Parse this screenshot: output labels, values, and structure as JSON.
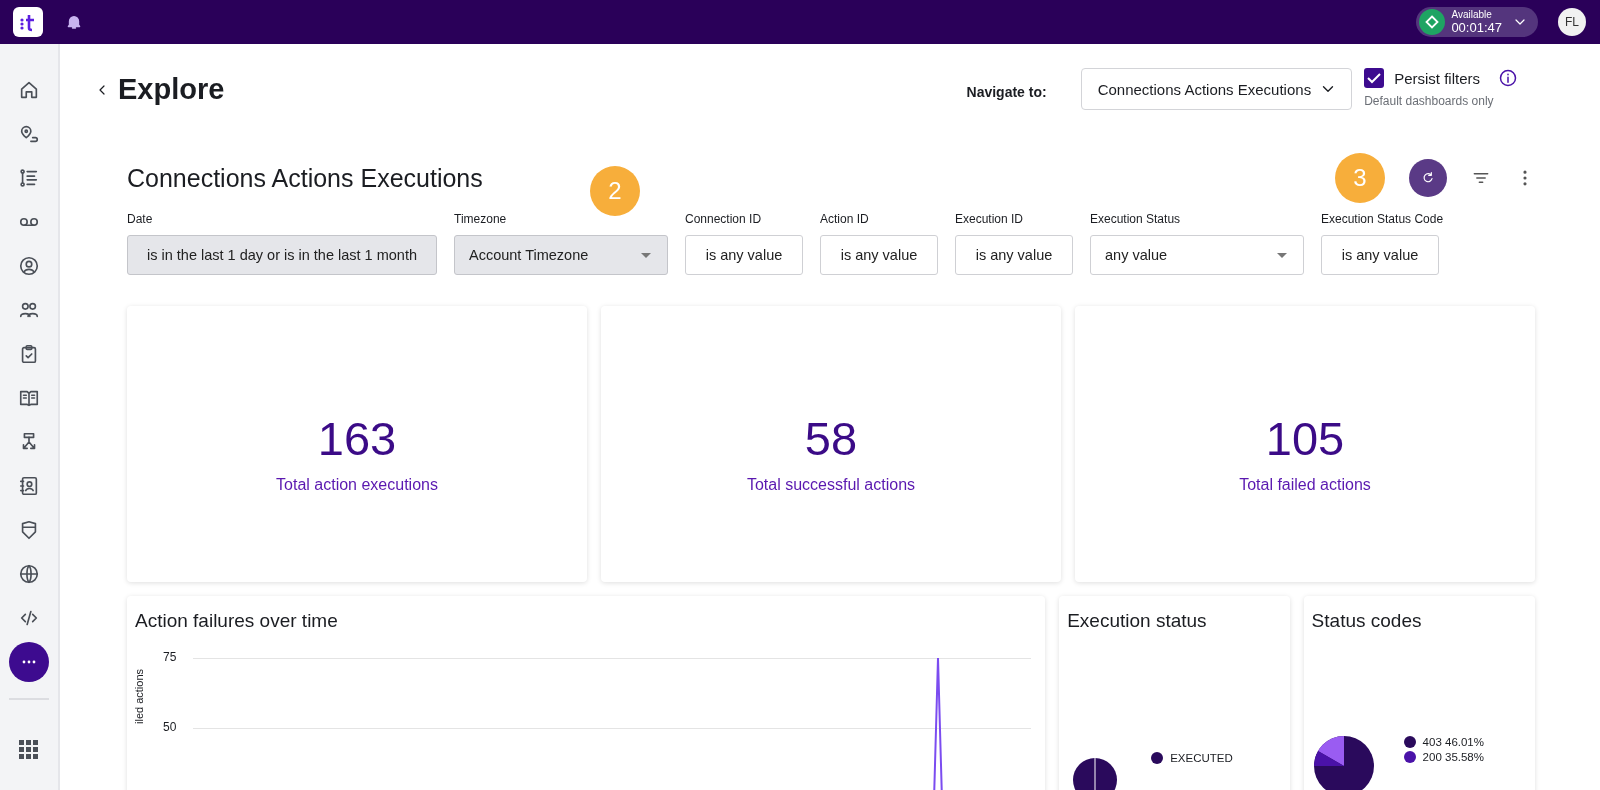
{
  "topbar": {
    "status": {
      "label": "Available",
      "timer": "00:01:47"
    },
    "avatar": "FL"
  },
  "page": {
    "title": "Explore",
    "navigate_label": "Navigate to:",
    "navigate_value": "Connections Actions Executions",
    "persist": {
      "label": "Persist filters",
      "checked": true,
      "hint": "Default dashboards only"
    }
  },
  "dashboard": {
    "title": "Connections Actions Executions",
    "filters": [
      {
        "label": "Date",
        "value": "is in the last 1 day or is in the last 1 month",
        "kind": "text",
        "highlighted": true
      },
      {
        "label": "Timezone",
        "value": "Account Timezone",
        "kind": "select",
        "highlighted": true
      },
      {
        "label": "Connection ID",
        "value": "is any value",
        "kind": "text",
        "highlighted": false
      },
      {
        "label": "Action ID",
        "value": "is any value",
        "kind": "text",
        "highlighted": false
      },
      {
        "label": "Execution ID",
        "value": "is any value",
        "kind": "text",
        "highlighted": false
      },
      {
        "label": "Execution Status",
        "value": "any value",
        "kind": "select",
        "highlighted": false
      },
      {
        "label": "Execution Status Code",
        "value": "is any value",
        "kind": "text",
        "highlighted": false
      }
    ],
    "kpis": [
      {
        "value": "163",
        "label": "Total action executions"
      },
      {
        "value": "58",
        "label": "Total successful actions"
      },
      {
        "value": "105",
        "label": "Total failed actions"
      }
    ],
    "failures_chart": {
      "title": "Action failures over time",
      "y_tick_labels": [
        "75",
        "50"
      ],
      "y_axis_title": "iled actions"
    },
    "execution_status": {
      "title": "Execution status",
      "legend": [
        {
          "label": "EXECUTED",
          "color": "#2a0a5c"
        }
      ]
    },
    "status_codes": {
      "title": "Status codes",
      "legend": [
        {
          "label": "403 46.01%",
          "color": "#2a0a5c"
        },
        {
          "label": "200 35.58%",
          "color": "#4a12a8"
        }
      ]
    }
  },
  "callouts": [
    "2",
    "3"
  ]
}
